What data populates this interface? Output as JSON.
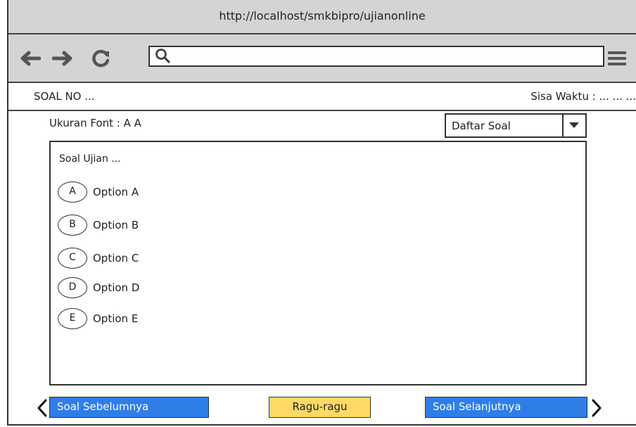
{
  "browser": {
    "url": "http://localhost/smkbipro/ujianonline",
    "search_value": ""
  },
  "header": {
    "question_number": "SOAL NO ...",
    "time_left": "Sisa Waktu : ... ... ..."
  },
  "font_size": {
    "label": "Ukuran Font : A A"
  },
  "question_list": {
    "selected": "Daftar Soal"
  },
  "question": {
    "text": "Soal Ujian ...",
    "options": [
      {
        "letter": "A",
        "label": "Option A"
      },
      {
        "letter": "B",
        "label": "Option B"
      },
      {
        "letter": "C",
        "label": "Option C"
      },
      {
        "letter": "D",
        "label": "Option D"
      },
      {
        "letter": "E",
        "label": "Option E"
      }
    ]
  },
  "footer": {
    "prev_label": "Soal Sebelumnya",
    "doubt_label": "Ragu-ragu",
    "next_label": "Soal Selanjutnya"
  },
  "colors": {
    "nav_button": "#2f7ee8",
    "doubt_button": "#ffd966",
    "browser_chrome": "#d4d4d4"
  },
  "icons": [
    "back-arrow-icon",
    "forward-arrow-icon",
    "reload-icon",
    "search-icon",
    "hamburger-menu-icon",
    "chevron-down-icon",
    "chevron-left-icon",
    "chevron-right-icon"
  ]
}
